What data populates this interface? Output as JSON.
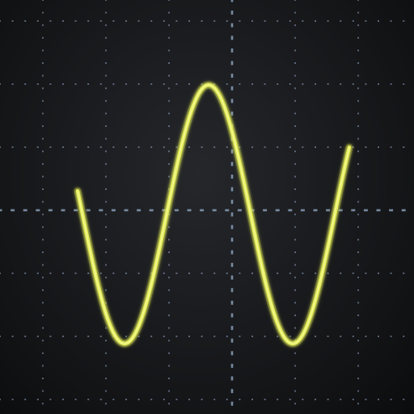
{
  "screen": {
    "background_color": "#1a1b1e",
    "grid_color": "#8fa6c2",
    "trace_color": "#e6ef5a",
    "trace_glow_color": "#c9d43a"
  },
  "graticule": {
    "minor_ticks_per_division": 5
  },
  "trace": {
    "waveform": "sine",
    "cycles_visible": 1.4
  }
}
